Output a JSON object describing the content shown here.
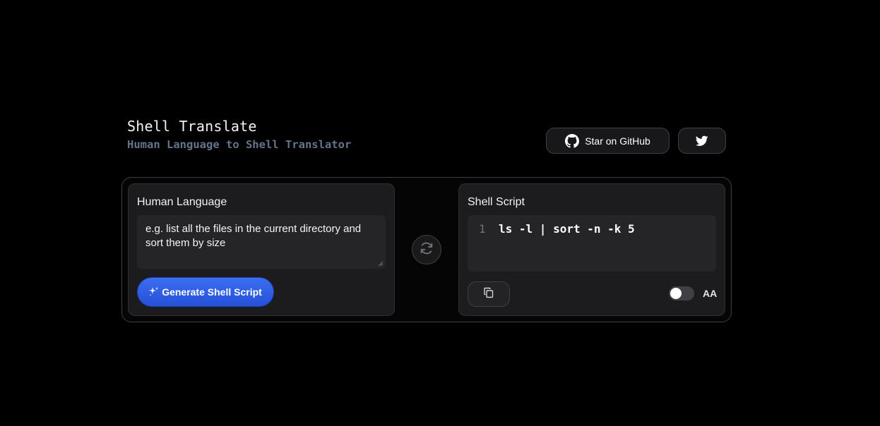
{
  "header": {
    "title": "Shell Translate",
    "subtitle": "Human Language to Shell Translator",
    "github_label": "Star on GitHub",
    "github_icon": "github-icon",
    "twitter_icon": "twitter-icon"
  },
  "input_panel": {
    "title": "Human Language",
    "input_value": "e.g. list all the files in the current directory and sort them by size",
    "generate_label": "Generate Shell Script",
    "generate_icon": "sparkle-icon",
    "accent_color": "#2f5fe6"
  },
  "swap": {
    "icon": "swap-arrows-icon"
  },
  "output_panel": {
    "title": "Shell Script",
    "line_number": "1",
    "code": "ls -l | sort -n -k 5",
    "copy_icon": "copy-icon",
    "toggle_state": "off",
    "font_toggle_label": "AA"
  }
}
